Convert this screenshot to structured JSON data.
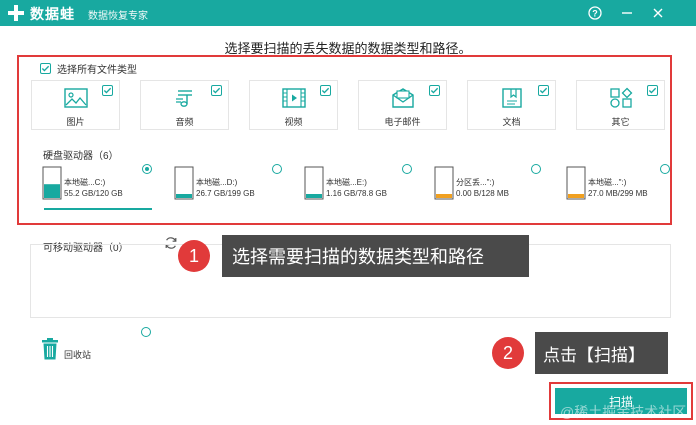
{
  "titlebar": {
    "app_name": "数据蛙",
    "subtitle": "数据恢复专家",
    "help_label": "?",
    "minimize_label": "—",
    "close_label": "✕"
  },
  "heading": "选择要扫描的丢失数据的数据类型和路径。",
  "select_all_label": "选择所有文件类型",
  "file_types": [
    {
      "label": "图片",
      "icon": "image-icon",
      "checked": true
    },
    {
      "label": "音频",
      "icon": "music-icon",
      "checked": true
    },
    {
      "label": "视频",
      "icon": "video-icon",
      "checked": true
    },
    {
      "label": "电子邮件",
      "icon": "email-icon",
      "checked": true
    },
    {
      "label": "文档",
      "icon": "document-icon",
      "checked": true
    },
    {
      "label": "其它",
      "icon": "other-icon",
      "checked": true
    }
  ],
  "hard_drives": {
    "title": "硬盘驱动器（6）",
    "items": [
      {
        "name": "本地磁...C:)",
        "size": "55.2 GB/120 GB",
        "selected": true,
        "fill": 0.46,
        "color": "#18a9a0"
      },
      {
        "name": "本地磁...D:)",
        "size": "26.7 GB/199 GB",
        "selected": false,
        "fill": 0.13,
        "color": "#18a9a0"
      },
      {
        "name": "本地磁...E:)",
        "size": "1.16 GB/78.8 GB",
        "selected": false,
        "fill": 0.02,
        "color": "#18a9a0"
      },
      {
        "name": "分区丢...\":)",
        "size": "0.00  B/128 MB",
        "selected": false,
        "fill": 0.0,
        "color": "#f0a020"
      },
      {
        "name": "本地磁...\":)",
        "size": "27.0 MB/299 MB",
        "selected": false,
        "fill": 0.09,
        "color": "#f0a020"
      }
    ]
  },
  "removable": {
    "title": "可移动驱动器（0）"
  },
  "recycle_bin_label": "回收站",
  "tip1": {
    "number": "1",
    "text": "选择需要扫描的数据类型和路径"
  },
  "tip2": {
    "number": "2",
    "text": "点击【扫描】"
  },
  "scan_button_label": "扫描",
  "watermark": "@稀土掘金技术社区",
  "colors": {
    "accent": "#18a9a0",
    "highlight": "#e13a3a",
    "warning": "#f0a020"
  }
}
